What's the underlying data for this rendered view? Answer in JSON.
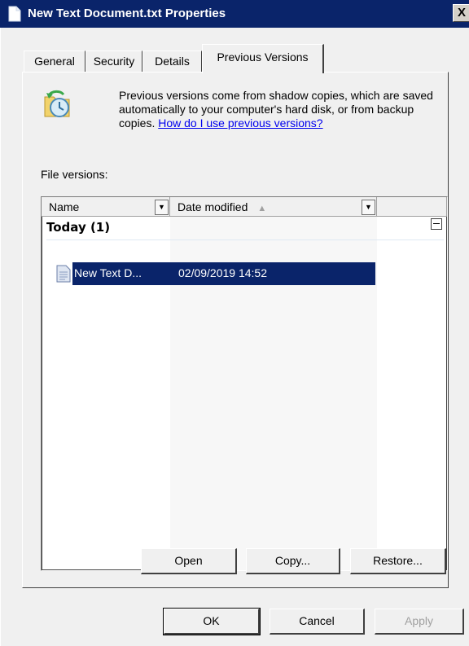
{
  "window": {
    "title": "New Text Document.txt Properties",
    "close_glyph": "X"
  },
  "tabs": [
    {
      "label": "General"
    },
    {
      "label": "Security"
    },
    {
      "label": "Details"
    },
    {
      "label": "Previous Versions",
      "active": true
    }
  ],
  "info": {
    "text": "Previous versions come from shadow copies, which are saved automatically to your computer's hard disk, or from backup copies. ",
    "link": "How do I use previous versions?"
  },
  "file_versions_label": "File versions:",
  "list": {
    "columns": [
      {
        "label": "Name"
      },
      {
        "label": "Date modified",
        "sort": "ascending"
      }
    ],
    "groups": [
      {
        "label": "Today (1)",
        "rows": [
          {
            "name": "New Text D...",
            "date_modified": "02/09/2019 14:52",
            "selected": true
          }
        ]
      }
    ]
  },
  "panel_buttons": {
    "open": "Open",
    "copy": "Copy...",
    "restore": "Restore..."
  },
  "dialog_buttons": {
    "ok": "OK",
    "cancel": "Cancel",
    "apply": "Apply"
  },
  "icons": [
    "document-icon",
    "close-icon",
    "shadow-copy-folder-icon",
    "dropdown-arrow-icon",
    "sort-up-icon",
    "collapse-icon",
    "text-file-icon"
  ],
  "colors": {
    "title_bar": "#0a246a",
    "selection": "#0a246a",
    "link": "#0000ee",
    "face": "#f0f0f0"
  }
}
